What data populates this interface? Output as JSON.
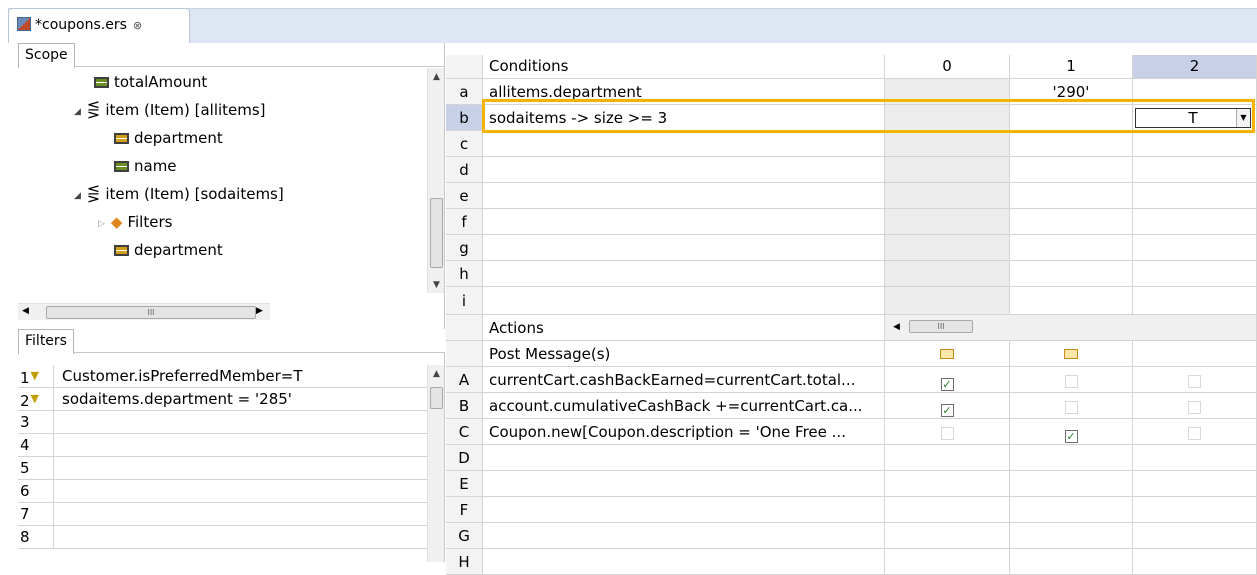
{
  "editor": {
    "tab_title": "*coupons.ers",
    "close_glyph": "⊗"
  },
  "scope": {
    "tab_label": "Scope",
    "items": [
      {
        "label": "totalAmount",
        "icon": "field-green-icon"
      },
      {
        "label": "item (Item) [allitems]",
        "icon": "collection-icon"
      },
      {
        "label": "department",
        "icon": "field-yellow-icon"
      },
      {
        "label": "name",
        "icon": "field-green-icon"
      },
      {
        "label": "item (Item) [sodaitems]",
        "icon": "collection-icon"
      },
      {
        "label": "Filters",
        "icon": "filter-folder-icon"
      },
      {
        "label": "department",
        "icon": "field-yellow-icon"
      }
    ],
    "hscroll_grip": "III"
  },
  "filters": {
    "tab_label": "Filters",
    "rows": [
      {
        "num": "1",
        "text": "Customer.isPreferredMember=T"
      },
      {
        "num": "2",
        "text": "sodaitems.department = '285'"
      },
      {
        "num": "3",
        "text": ""
      },
      {
        "num": "4",
        "text": ""
      },
      {
        "num": "5",
        "text": ""
      },
      {
        "num": "6",
        "text": ""
      },
      {
        "num": "7",
        "text": ""
      },
      {
        "num": "8",
        "text": ""
      }
    ]
  },
  "conditions": {
    "header": "Conditions",
    "columns": [
      "0",
      "1",
      "2"
    ],
    "rows": [
      {
        "label": "a",
        "text": "allitems.department",
        "values": [
          "",
          "'290'",
          ""
        ]
      },
      {
        "label": "b",
        "text": "sodaitems -> size >= 3",
        "values": [
          "",
          "",
          "T"
        ]
      },
      {
        "label": "c",
        "text": "",
        "values": [
          "",
          "",
          ""
        ]
      },
      {
        "label": "d",
        "text": "",
        "values": [
          "",
          "",
          ""
        ]
      },
      {
        "label": "e",
        "text": "",
        "values": [
          "",
          "",
          ""
        ]
      },
      {
        "label": "f",
        "text": "",
        "values": [
          "",
          "",
          ""
        ]
      },
      {
        "label": "g",
        "text": "",
        "values": [
          "",
          "",
          ""
        ]
      },
      {
        "label": "h",
        "text": "",
        "values": [
          "",
          "",
          ""
        ]
      },
      {
        "label": "i",
        "text": "",
        "values": [
          "",
          "",
          ""
        ]
      }
    ]
  },
  "actions": {
    "header": "Actions",
    "post_message": "Post Message(s)",
    "hscroll_grip": "III",
    "rows": [
      {
        "label": "A",
        "text": "currentCart.cashBackEarned=currentCart.total...",
        "checks": [
          true,
          false,
          false
        ]
      },
      {
        "label": "B",
        "text": "account.cumulativeCashBack +=currentCart.ca...",
        "checks": [
          true,
          false,
          false
        ]
      },
      {
        "label": "C",
        "text": "Coupon.new[Coupon.description = 'One Free ...",
        "checks": [
          false,
          true,
          false
        ]
      },
      {
        "label": "D",
        "text": "",
        "checks": null
      },
      {
        "label": "E",
        "text": "",
        "checks": null
      },
      {
        "label": "F",
        "text": "",
        "checks": null
      },
      {
        "label": "G",
        "text": "",
        "checks": null
      },
      {
        "label": "H",
        "text": "",
        "checks": null
      }
    ]
  },
  "colors": {
    "accent_selected": "#c8d0e8",
    "highlight_box": "#f4b400",
    "check_green": "#2a7a2a"
  }
}
